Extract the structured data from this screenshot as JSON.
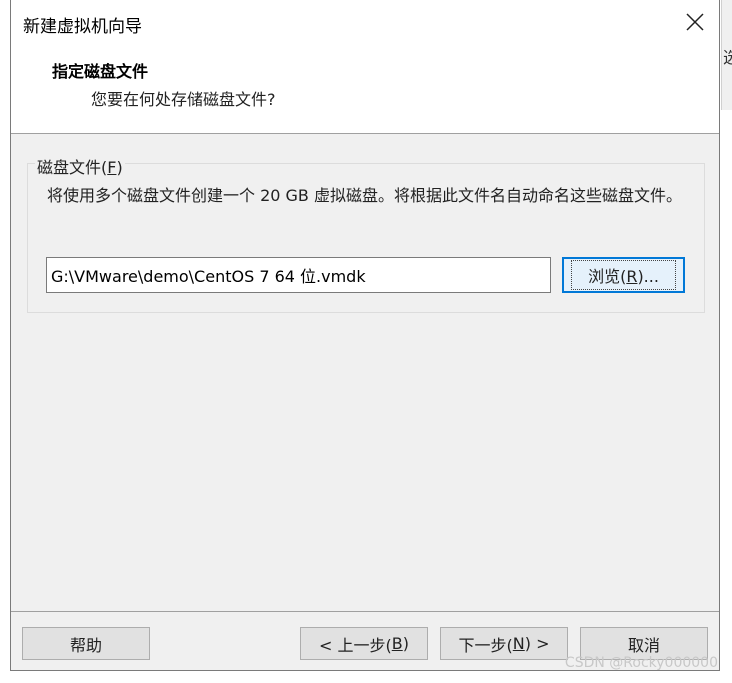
{
  "background": {
    "partial_char": "选"
  },
  "window": {
    "title": "新建虚拟机向导"
  },
  "header": {
    "title": "指定磁盘文件",
    "subtitle": "您要在何处存储磁盘文件?"
  },
  "disk_group": {
    "label_prefix": "磁盘文件(",
    "label_accel": "F",
    "label_suffix": ")",
    "description": "将使用多个磁盘文件创建一个 20 GB 虚拟磁盘。将根据此文件名自动命名这些磁盘文件。",
    "file_path": "G:\\VMware\\demo\\CentOS 7 64 位.vmdk",
    "browse_prefix": "浏览(",
    "browse_accel": "R",
    "browse_suffix": ")..."
  },
  "buttons": {
    "help": "帮助",
    "back_prefix": "< 上一步(",
    "back_accel": "B",
    "back_suffix": ")",
    "next_prefix": "下一步(",
    "next_accel": "N",
    "next_suffix": ") >",
    "cancel": "取消"
  },
  "watermark": "CSDN @Rocky000000"
}
